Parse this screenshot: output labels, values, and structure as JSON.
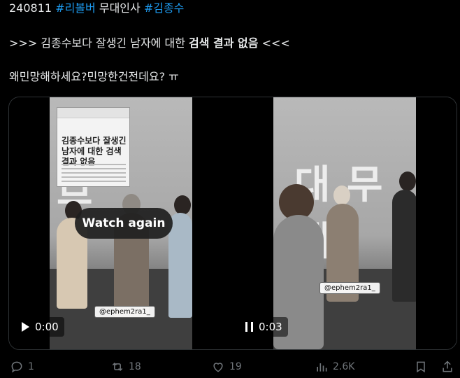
{
  "post": {
    "line1": {
      "date": "240811",
      "tag1": "#리볼버",
      "text": "무대인사",
      "tag2": "#김종수"
    },
    "line2": {
      "prefix": ">>> 김종수보다 잘생긴 남자에 대한",
      "bold": "검색 결과 없음",
      "suffix": "<<<"
    },
    "line3": "왜민망해하세요?민망한건전데요? ㅠ"
  },
  "media": {
    "video1": {
      "overlay_button": "Watch again",
      "time": "0:00",
      "screen_text": "무",
      "inset": {
        "title": "김종수보다 잘생긴 남자에 대한 검색 결과 없음"
      },
      "watermark": "@ephem2ra1_"
    },
    "video2": {
      "time": "0:03",
      "screen_text": "대 무대",
      "watermark": "@ephem2ra1_"
    }
  },
  "actions": {
    "replies": "1",
    "reposts": "18",
    "likes": "19",
    "views": "2.6K"
  },
  "colors": {
    "accent": "#1d9bf0",
    "muted": "#71767b",
    "text": "#e7e9ea"
  },
  "icons": [
    "reply-icon",
    "repost-icon",
    "like-icon",
    "views-icon",
    "bookmark-icon",
    "share-icon",
    "play-icon",
    "pause-icon"
  ]
}
